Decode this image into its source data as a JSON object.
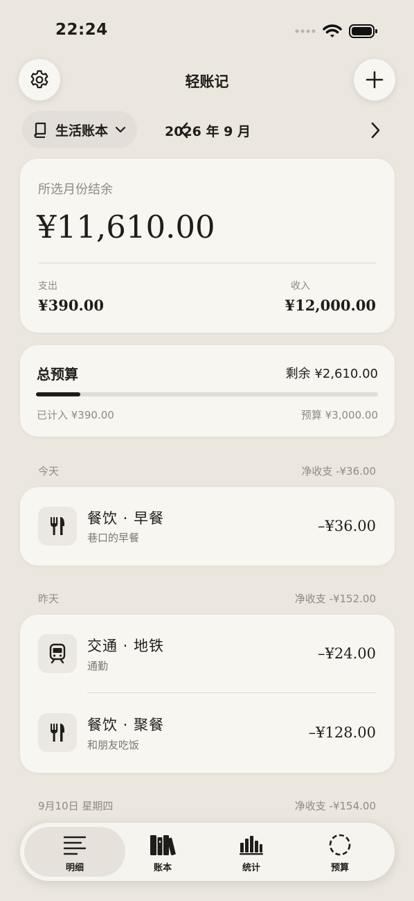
{
  "status": {
    "time": "22:24"
  },
  "header": {
    "title": "轻账记"
  },
  "book": {
    "name": "生活账本"
  },
  "month": {
    "label": "2026 年 9 月"
  },
  "balance": {
    "label": "所选月份结余",
    "amount": "¥11,610.00",
    "expense_label": "支出",
    "expense": "¥390.00",
    "income_label": "收入",
    "income": "¥12,000.00"
  },
  "budget": {
    "title": "总预算",
    "remaining": "剩余 ¥2,610.00",
    "spent": "已计入 ¥390.00",
    "total": "预算 ¥3,000.00",
    "progress": 0.13
  },
  "groups": [
    {
      "label": "今天",
      "net": "净收支 -¥36.00",
      "items": [
        {
          "icon": "fork-knife-icon",
          "title": "餐饮 · 早餐",
          "note": "巷口的早餐",
          "amount": "–¥36.00"
        }
      ]
    },
    {
      "label": "昨天",
      "net": "净收支 -¥152.00",
      "items": [
        {
          "icon": "train-icon",
          "title": "交通 · 地铁",
          "note": "通勤",
          "amount": "–¥24.00"
        },
        {
          "icon": "fork-knife-icon",
          "title": "餐饮 · 聚餐",
          "note": "和朋友吃饭",
          "amount": "–¥128.00"
        }
      ]
    },
    {
      "label": "9月10日 星期四",
      "net": "净收支 -¥154.00",
      "items": []
    }
  ],
  "tabs": [
    {
      "label": "明细",
      "icon": "list-icon",
      "active": true
    },
    {
      "label": "账本",
      "icon": "books-icon",
      "active": false
    },
    {
      "label": "统计",
      "icon": "bar-chart-icon",
      "active": false
    },
    {
      "label": "预算",
      "icon": "dashed-circle-icon",
      "active": false
    }
  ]
}
